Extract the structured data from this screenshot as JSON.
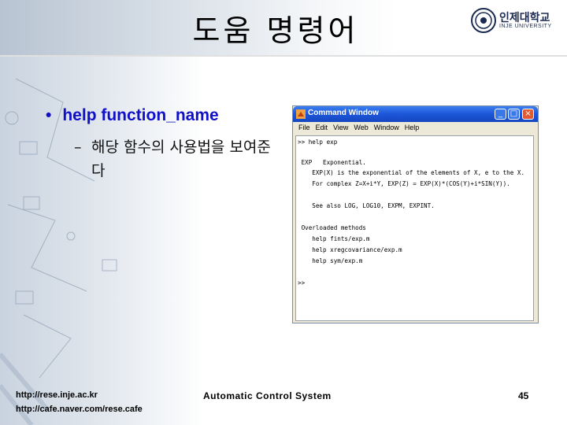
{
  "slide": {
    "title": "도움 명령어",
    "bullet": "help function_name",
    "bullet_marker": "•",
    "sub_dash": "–",
    "sub_text": "해당 함수의 사용법을 보여준다",
    "footer_left_1": "http://rese.inje.ac.kr",
    "footer_left_2": "http://cafe.naver.com/rese.cafe",
    "footer_center": "Automatic Control System",
    "page_number": "45"
  },
  "logo": {
    "name": "인제대학교",
    "subtitle": "INJE UNIVERSITY",
    "icon": "university-seal-icon"
  },
  "command_window": {
    "title": "Command Window",
    "menu": [
      "File",
      "Edit",
      "View",
      "Web",
      "Window",
      "Help"
    ],
    "lines": [
      ">> help exp",
      "",
      " EXP   Exponential.",
      "    EXP(X) is the exponential of the elements of X, e to the X.",
      "    For complex Z=X+i*Y, EXP(Z) = EXP(X)*(COS(Y)+i*SIN(Y)).",
      "",
      "    See also LOG, LOG10, EXPM, EXPINT.",
      "",
      " Overloaded methods",
      "    help fints/exp.m",
      "    help xregcovariance/exp.m",
      "    help sym/exp.m",
      "",
      ">>"
    ]
  },
  "colors": {
    "bullet": "#1010c8",
    "titlebar": "#1c56d8"
  }
}
